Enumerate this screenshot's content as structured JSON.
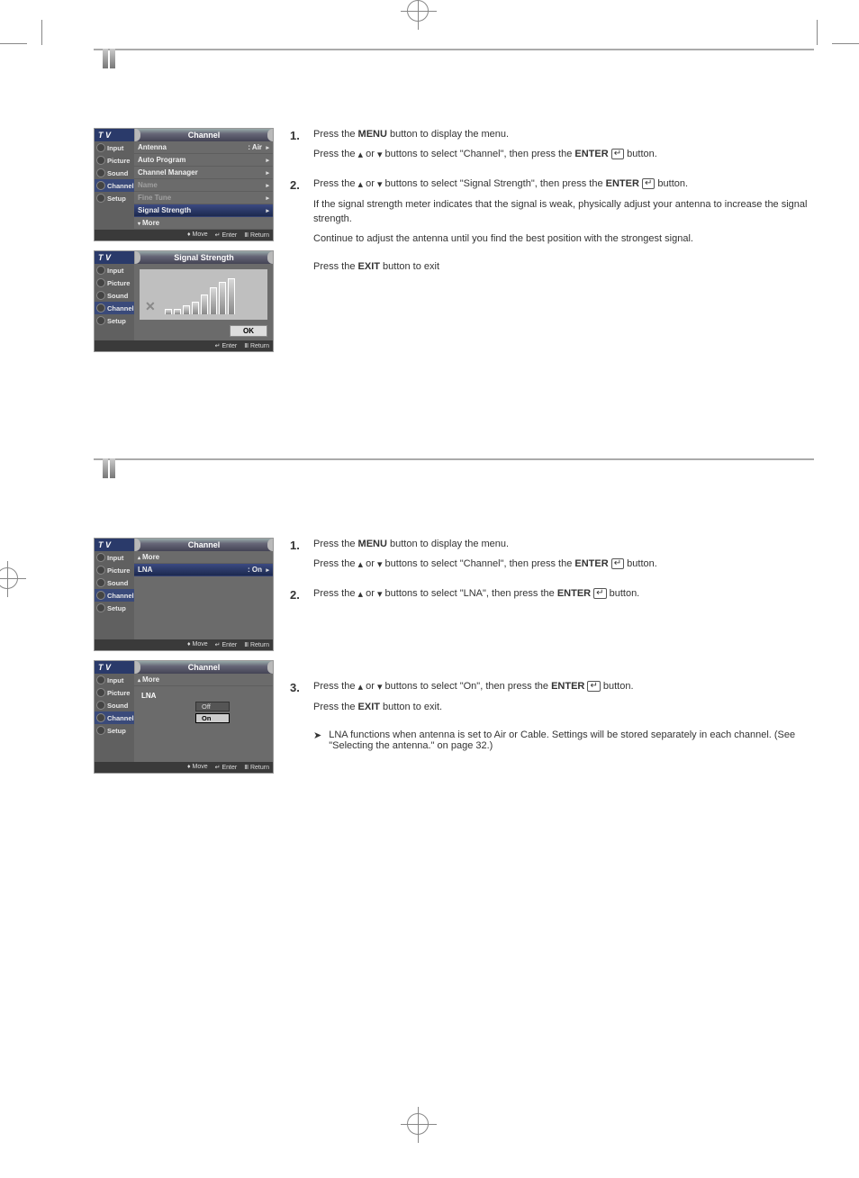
{
  "tv_label": "T V",
  "sidebar": [
    "Input",
    "Picture",
    "Sound",
    "Channel",
    "Setup"
  ],
  "footer": {
    "move": "Move",
    "enter": "Enter",
    "return": "Return"
  },
  "ok_label": "OK",
  "section1": {
    "shot1": {
      "title": "Channel",
      "items": [
        {
          "label": "Antenna",
          "value": ": Air"
        },
        {
          "label": "Auto Program"
        },
        {
          "label": "Channel Manager"
        },
        {
          "label": "Name",
          "disabled": true
        },
        {
          "label": "Fine Tune",
          "disabled": true
        },
        {
          "label": "Signal Strength",
          "highlight": true
        },
        {
          "label": "More",
          "more": true
        }
      ]
    },
    "shot2": {
      "title": "Signal Strength"
    },
    "steps": {
      "s1a": "Press the ",
      "s1b": " button to display the menu.",
      "s1c": "Press the ",
      "s1d": " or ",
      "s1e": " buttons to select \"Channel\", then press the ",
      "s1f": " button.",
      "s2a": "Press the ",
      "s2b": " or ",
      "s2c": " buttons to select \"Signal Strength\", then press the ",
      "s2d": " button.",
      "s2e": "If the signal strength meter indicates that the signal is weak, physically adjust your antenna to increase the signal strength.",
      "s2f": "Continue to adjust the antenna until you find the best position with the strongest signal.",
      "exit_a": "Press the ",
      "exit_b": " button to exit",
      "menu_btn": "MENU",
      "enter_btn": "ENTER",
      "exit_btn": "EXIT"
    }
  },
  "section2": {
    "shot1": {
      "title": "Channel",
      "more_label": "More",
      "lna_label": "LNA",
      "lna_value": ": On"
    },
    "shot2": {
      "title": "Channel",
      "more_label": "More",
      "lna_label": "LNA",
      "options": [
        "Off",
        "On"
      ],
      "selected": "On"
    },
    "steps": {
      "s1a": "Press the ",
      "s1b": " button to display the menu.",
      "s1c": "Press the ",
      "s1d": " or ",
      "s1e": " buttons to select \"Channel\", then press the ",
      "s1f": " button.",
      "s2a": "Press the ",
      "s2b": " or ",
      "s2c": " buttons to select \"LNA\", then press the ",
      "s2d": " button.",
      "s3a": "Press the ",
      "s3b": " or ",
      "s3c": " buttons to select \"On\", then press the ",
      "s3d": " button.",
      "exit_a": "Press the ",
      "exit_b": " button to exit.",
      "note": "LNA functions when antenna is set to Air or Cable. Settings will be stored separately in each channel. (See \"Selecting the antenna.\" on page 32.)",
      "menu_btn": "MENU",
      "enter_btn": "ENTER",
      "exit_btn": "EXIT"
    }
  }
}
